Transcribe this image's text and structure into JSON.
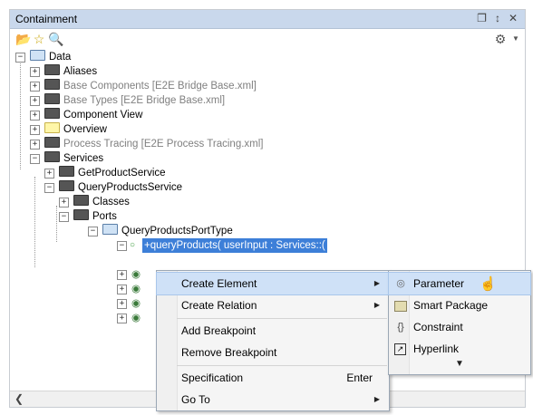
{
  "panel": {
    "title": "Containment",
    "controls": [
      "restore-icon",
      "pin-icon",
      "close-icon"
    ]
  },
  "tree": {
    "root": "Data",
    "aliases": "Aliases",
    "base_components": "Base Components [E2E Bridge Base.xml]",
    "base_types": "Base Types [E2E Bridge Base.xml]",
    "component_view": "Component View",
    "overview": "Overview",
    "process_tracing": "Process Tracing [E2E Process Tracing.xml]",
    "services": "Services",
    "get_product_service": "GetProductService",
    "query_products_service": "QueryProductsService",
    "classes": "Classes",
    "ports": "Ports",
    "port_type": "QueryProductsPortType",
    "operation": "+queryProducts( userInput : Services::("
  },
  "context_menu": {
    "items": [
      {
        "label": "Create Element",
        "submenu": true
      },
      {
        "label": "Create Relation",
        "submenu": true
      },
      {
        "label": "Add Breakpoint"
      },
      {
        "label": "Remove Breakpoint"
      },
      {
        "label": "Specification",
        "shortcut": "Enter"
      },
      {
        "label": "Go To",
        "submenu": true
      }
    ]
  },
  "submenu": {
    "items": [
      {
        "label": "Parameter",
        "icon": "parameter-icon"
      },
      {
        "label": "Smart Package",
        "icon": "smart-package-icon"
      },
      {
        "label": "Constraint",
        "icon": "constraint-icon",
        "glyph": "{}"
      },
      {
        "label": "Hyperlink",
        "icon": "hyperlink-icon"
      }
    ]
  },
  "colors": {
    "selection": "#3d7fd8",
    "titlebar": "#c9d8ec",
    "menu_highlight": "#cfe1f7"
  }
}
